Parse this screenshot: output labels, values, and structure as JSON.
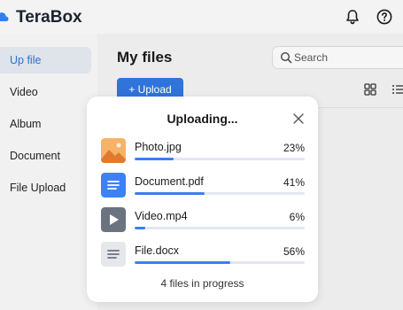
{
  "app": {
    "name": "TeraBox",
    "brand_color": "#2f80ed",
    "header_icons": [
      "bell-icon",
      "help-icon"
    ]
  },
  "sidebar": {
    "items": [
      {
        "label": "Up file",
        "icon": "upload-icon",
        "active": true
      },
      {
        "label": "Video",
        "icon": "video-icon",
        "active": false
      },
      {
        "label": "Album",
        "icon": "album-icon",
        "active": false
      },
      {
        "label": "Document",
        "icon": "document-icon",
        "active": false
      },
      {
        "label": "File Upload",
        "icon": "file-upload-icon",
        "active": false
      }
    ]
  },
  "main": {
    "title": "My files",
    "search": {
      "placeholder": "Search",
      "value": ""
    },
    "upload_button": "+ Upload",
    "view_icons": [
      "grid-view-icon",
      "list-view-icon"
    ]
  },
  "upload_dialog": {
    "title": "Uploading...",
    "files": [
      {
        "name": "Photo.jpg",
        "percent_label": "23%",
        "progress": 0.23,
        "type": "image"
      },
      {
        "name": "Document.pdf",
        "percent_label": "41%",
        "progress": 0.41,
        "type": "document"
      },
      {
        "name": "Video.mp4",
        "percent_label": "6%",
        "progress": 0.06,
        "type": "video"
      },
      {
        "name": "File.docx",
        "percent_label": "56%",
        "progress": 0.56,
        "type": "file"
      }
    ],
    "footer": "4 files in progress"
  },
  "colors": {
    "accent": "#2f73db",
    "progress": "#3a7ef0",
    "active_nav_bg": "#dfe3ea"
  }
}
